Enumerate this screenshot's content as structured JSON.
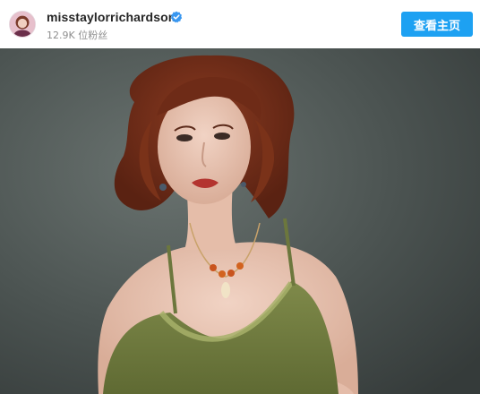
{
  "post": {
    "username": "misstaylorrichardson",
    "followers": "12.9K 位粉丝",
    "view_profile_label": "查看主页",
    "accent_color": "#1da1f2"
  },
  "icons": {
    "verified": "verified-badge-icon",
    "avatar": "profile-avatar"
  }
}
